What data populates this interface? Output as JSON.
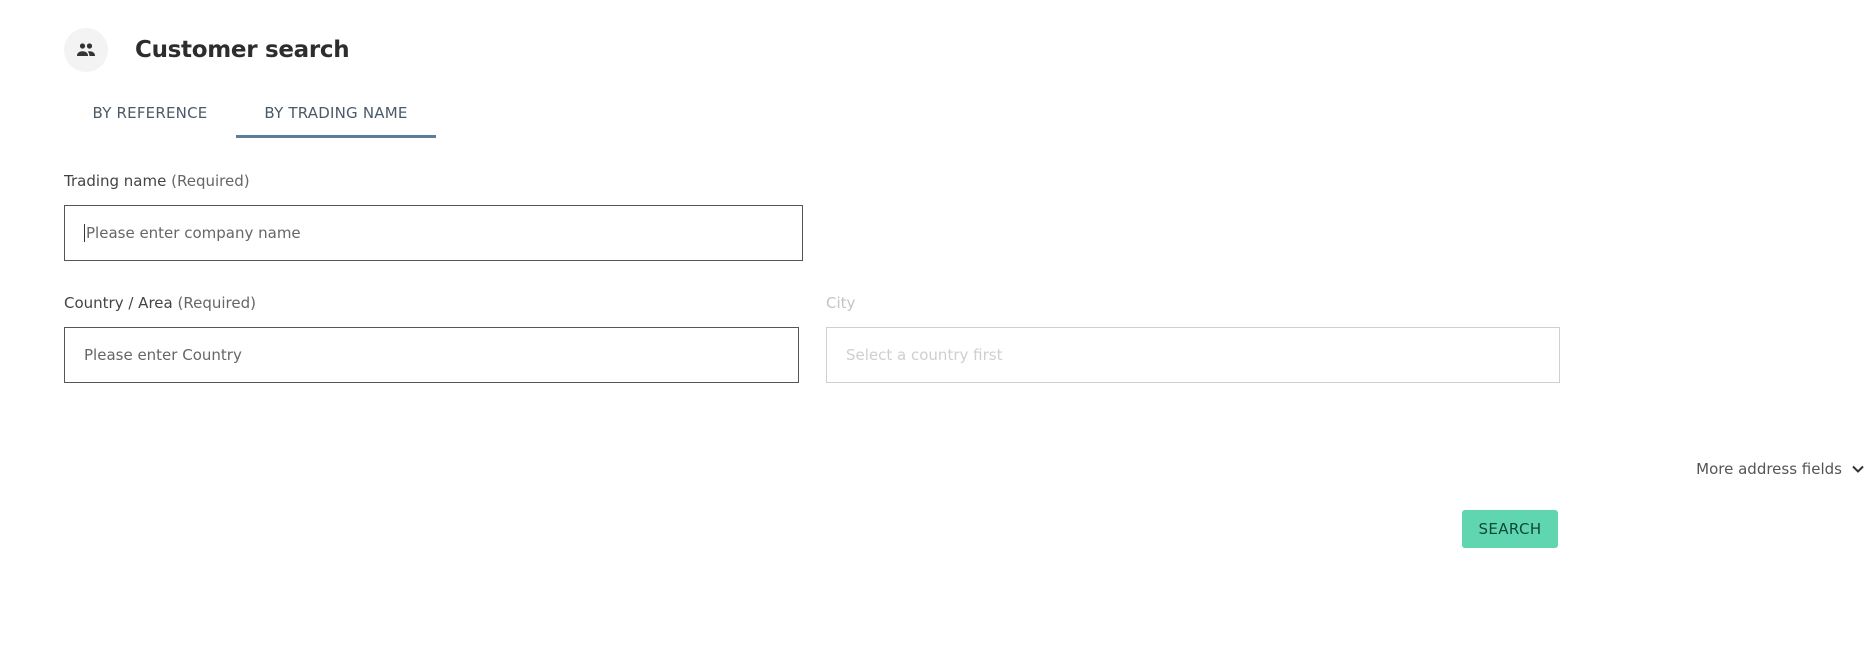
{
  "header": {
    "title": "Customer search",
    "icon": "people-icon"
  },
  "tabs": [
    {
      "label": "BY REFERENCE",
      "active": false
    },
    {
      "label": "BY TRADING NAME",
      "active": true
    }
  ],
  "form": {
    "trading_name": {
      "label": "Trading name",
      "required": "(Required)",
      "placeholder": "Please enter company name",
      "value": ""
    },
    "country": {
      "label": "Country / Area",
      "required": "(Required)",
      "placeholder": "Please enter Country",
      "value": ""
    },
    "city": {
      "label": "City",
      "placeholder": "Select a country first",
      "disabled": true
    }
  },
  "more_fields": {
    "label": "More address fields",
    "icon": "chevron-down-icon"
  },
  "search_button": {
    "label": "SEARCH"
  },
  "colors": {
    "tab_underline": "#5d7c96",
    "search_button": "#5fd6b0"
  }
}
